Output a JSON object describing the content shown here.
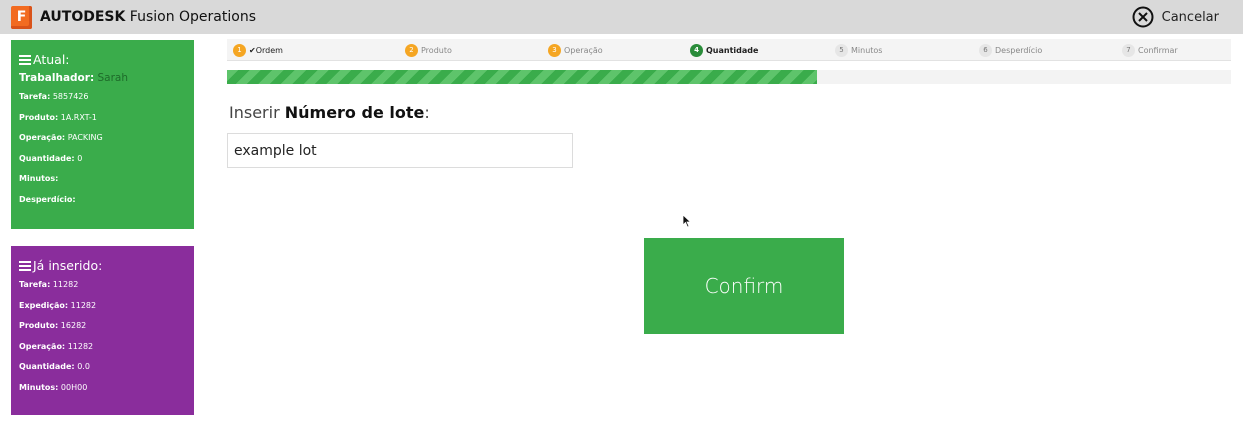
{
  "app": {
    "logo_letter": "F",
    "brand": "AUTODESK",
    "product": "Fusion Operations",
    "brand_color": "#f26b21"
  },
  "header": {
    "cancel_label": "Cancelar",
    "cancel_icon": "close-circle-icon"
  },
  "current_panel": {
    "title": "Atual:",
    "icon": "menu-icon",
    "color": "#3aac4b",
    "worker_label": "Trabalhador:",
    "worker_value": "Sarah",
    "rows": [
      {
        "label": "Tarefa:",
        "value": "5857426"
      },
      {
        "label": "Produto:",
        "value": "1A.RXT-1"
      },
      {
        "label": "Operação:",
        "value": "PACKING"
      },
      {
        "label": "Quantidade:",
        "value": "0"
      },
      {
        "label": "Minutos:",
        "value": ""
      },
      {
        "label": "Desperdício:",
        "value": ""
      }
    ]
  },
  "entered_panel": {
    "title": "Já inserido:",
    "icon": "menu-icon",
    "color": "#8a2d9c",
    "rows": [
      {
        "label": "Tarefa:",
        "value": "11282"
      },
      {
        "label": "Expedição:",
        "value": "11282"
      },
      {
        "label": "Produto:",
        "value": "16282"
      },
      {
        "label": "Operação:",
        "value": "11282"
      },
      {
        "label": "Quantidade:",
        "value": "0.0"
      },
      {
        "label": "Minutos:",
        "value": "00H00"
      }
    ]
  },
  "steps": [
    {
      "num": "1",
      "label": "✔Ordem",
      "state": "done"
    },
    {
      "num": "2",
      "label": "Produto",
      "state": "done"
    },
    {
      "num": "3",
      "label": "Operação",
      "state": "done"
    },
    {
      "num": "4",
      "label": "Quantidade",
      "state": "active"
    },
    {
      "num": "5",
      "label": "Minutos",
      "state": "pending"
    },
    {
      "num": "6",
      "label": "Desperdício",
      "state": "pending"
    },
    {
      "num": "7",
      "label": "Confirmar",
      "state": "pending"
    }
  ],
  "progress": {
    "fraction": 0.588,
    "fill_color": "#3aac4b"
  },
  "form": {
    "prompt_prefix": "Inserir ",
    "prompt_bold": "Número de lote",
    "prompt_suffix": ":",
    "lot_value": "example lot"
  },
  "confirm_label": "Confirm"
}
